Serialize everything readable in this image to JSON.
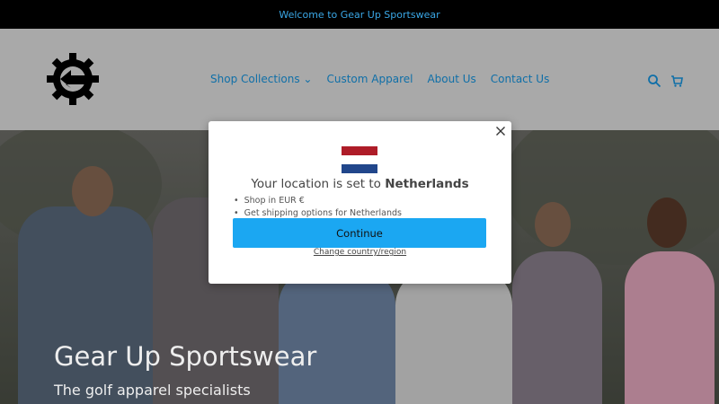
{
  "announcement": {
    "text": "Welcome to Gear Up Sportswear"
  },
  "header": {
    "logo_icon": "gear-g-logo",
    "nav": [
      {
        "label": "Shop Collections ⌄"
      },
      {
        "label": "Custom Apparel"
      },
      {
        "label": "About Us"
      },
      {
        "label": "Contact Us"
      }
    ],
    "search_icon": "search-icon",
    "cart_icon": "cart-icon",
    "link_color": "#0f6fa8"
  },
  "hero": {
    "title": "Gear Up Sportswear",
    "subtitle": "The golf apparel specialists"
  },
  "modal": {
    "flag_colors": [
      "#ae1c28",
      "#ffffff",
      "#21468b"
    ],
    "title_prefix": "Your location is set to",
    "country": "Netherlands",
    "bullets": [
      "Shop in EUR €",
      "Get shipping options for Netherlands"
    ],
    "button_label": "Continue",
    "button_color": "#1ba7f2",
    "change_link": "Change country/region"
  }
}
